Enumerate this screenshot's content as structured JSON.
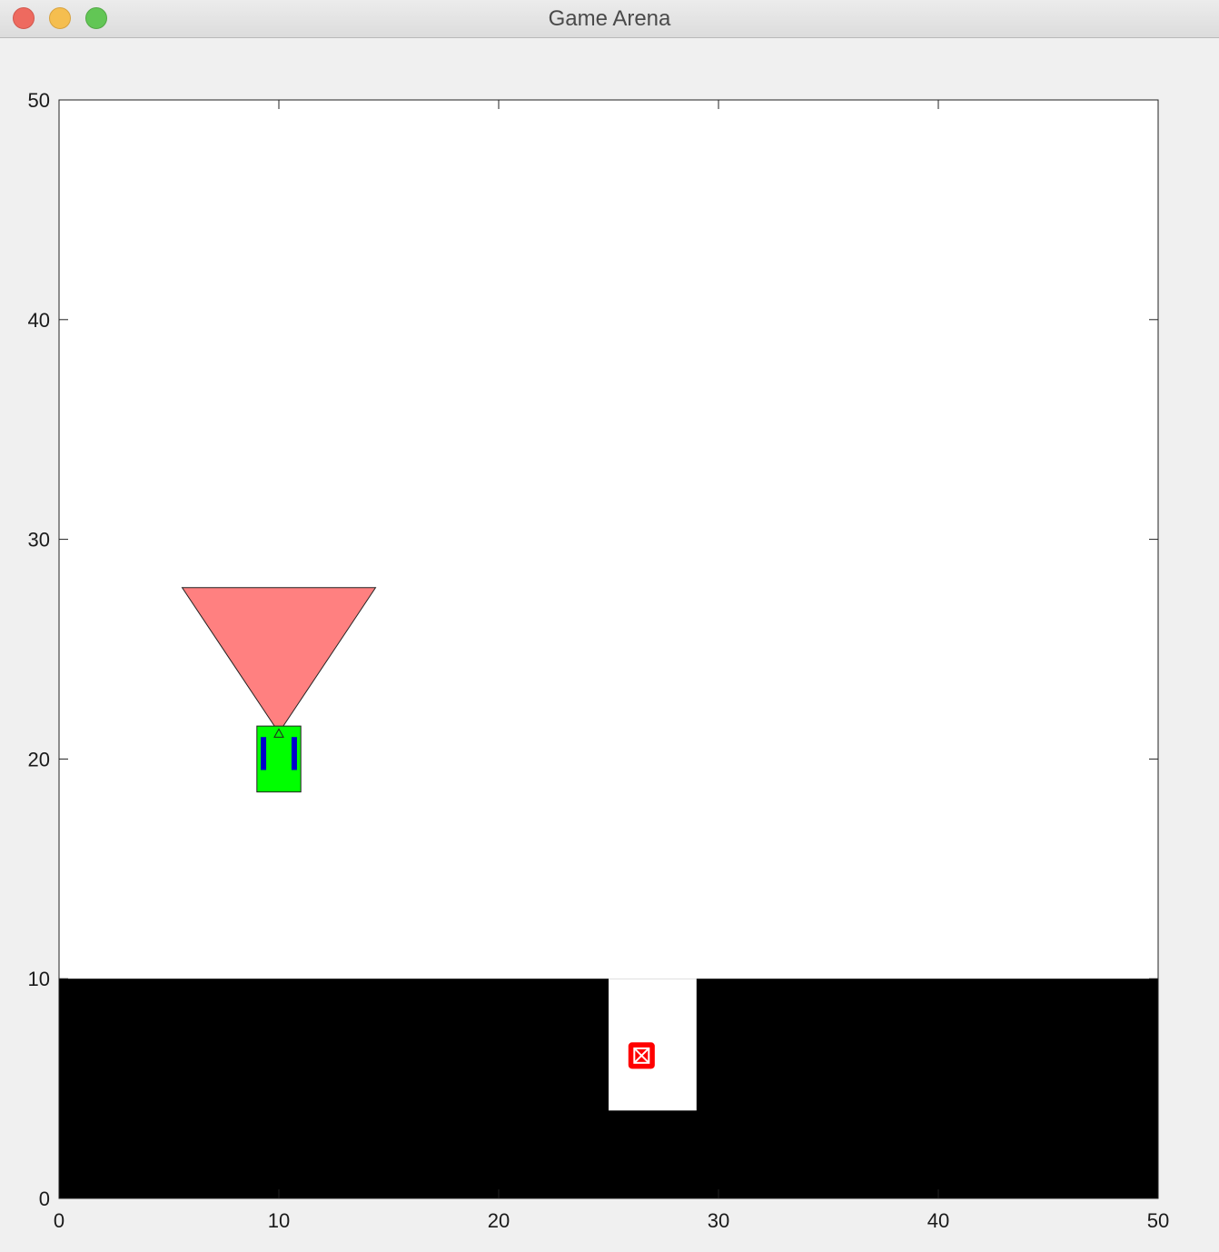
{
  "window": {
    "title": "Game Arena"
  },
  "chart_data": {
    "type": "scatter",
    "xlim": [
      0,
      50
    ],
    "ylim": [
      0,
      50
    ],
    "x_ticks": [
      "0",
      "10",
      "20",
      "30",
      "40",
      "50"
    ],
    "y_ticks": [
      "0",
      "10",
      "20",
      "30",
      "40",
      "50"
    ],
    "grid": false,
    "terrain": {
      "color": "#000000",
      "ground": {
        "x": [
          0,
          50
        ],
        "y": [
          0,
          10
        ]
      },
      "pit": {
        "x": [
          25,
          29
        ],
        "y": [
          4,
          10
        ],
        "color": "#ffffff"
      }
    },
    "vehicle": {
      "body_color": "#00ff00",
      "stripe_color": "#0000cc",
      "x": [
        9,
        11
      ],
      "y": [
        18.5,
        21.5
      ],
      "stripe_x": [
        9.3,
        10.7
      ],
      "stripe_y": [
        19.5,
        21
      ]
    },
    "sensor_cone": {
      "color": "#ff8080",
      "apex": [
        10,
        21.2
      ],
      "base_left": [
        5.6,
        27.8
      ],
      "base_right": [
        14.4,
        27.8
      ]
    },
    "target": {
      "color": "#ff0000",
      "x": 26.5,
      "y": 6.5,
      "size": 1.2
    }
  }
}
